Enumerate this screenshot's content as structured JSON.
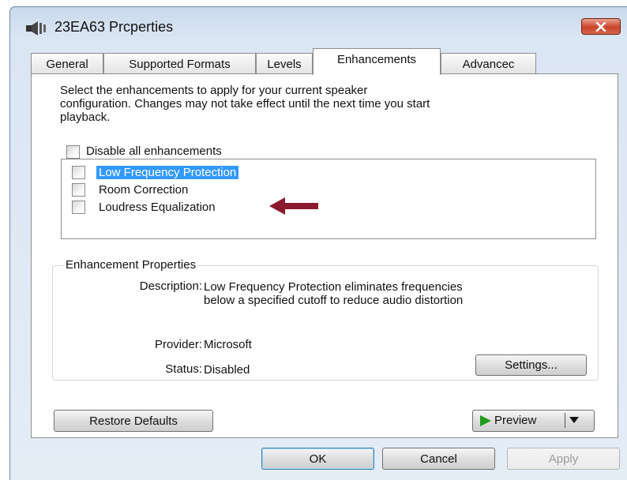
{
  "window": {
    "title": "23EA63 Prcperties",
    "close_icon": "close-x-icon"
  },
  "tabs": [
    {
      "label": "General",
      "active": false
    },
    {
      "label": "Supported Formats",
      "active": false
    },
    {
      "label": "Levels",
      "active": false
    },
    {
      "label": "Enhancements",
      "active": true
    },
    {
      "label": "Advancec",
      "active": false
    }
  ],
  "enhancements": {
    "intro_line1": "Select the enhancements to apply for your current speaker",
    "intro_line2": "configuration. Changes may not take effect until the next time you start",
    "intro_line3": "playback.",
    "disable_all_label": "Disable all enhancements",
    "disable_all_checked": false,
    "list": [
      {
        "label": "Low Frequency Protection",
        "checked": false,
        "selected": true
      },
      {
        "label": "Room Correction",
        "checked": false,
        "selected": false
      },
      {
        "label": "Loudress Equalization",
        "checked": false,
        "selected": false
      }
    ],
    "annotation_arrow_color": "#8b1a2e"
  },
  "properties": {
    "legend": "Enhancement Properties",
    "description_label": "Description:",
    "description_line1": "Low Frequency Protection eliminates frequencies",
    "description_line2": "below a specified cutoff to reduce audio distortion",
    "provider_label": "Provider:",
    "provider_value": "Microsoft",
    "status_label": "Status:",
    "status_value": "Disabled",
    "settings_button": "Settings..."
  },
  "buttons": {
    "restore_defaults": "Restore Defaults",
    "preview": "Preview",
    "ok": "OK",
    "cancel": "Cancel",
    "apply": "Apply"
  },
  "colors": {
    "selection": "#3399ff",
    "play_icon": "#1e9a1e",
    "close_button": "#c9442b"
  }
}
